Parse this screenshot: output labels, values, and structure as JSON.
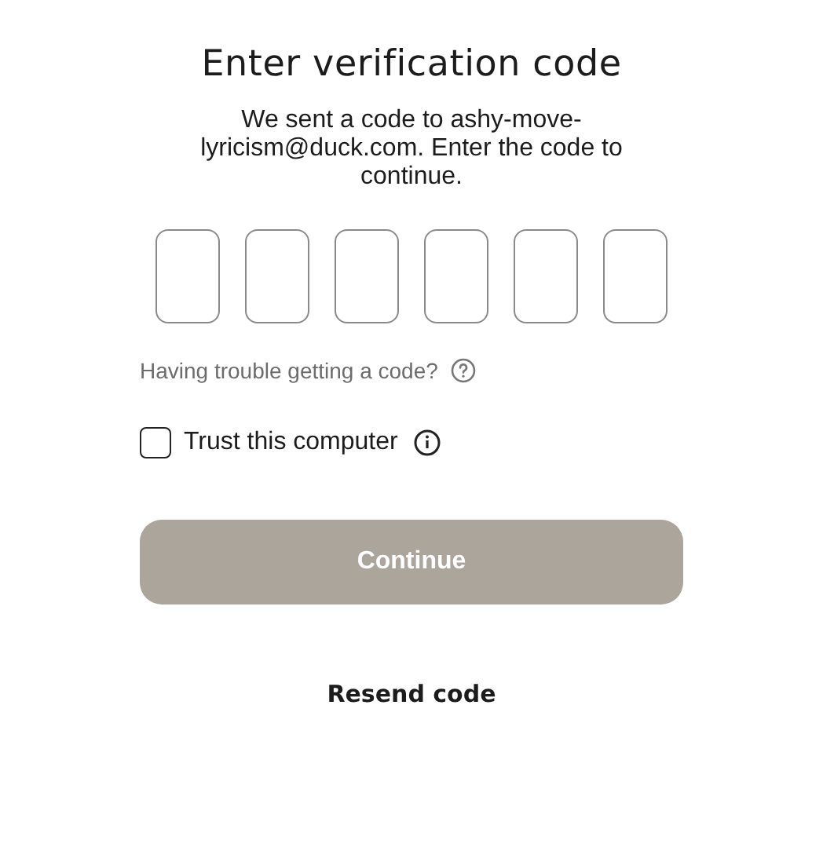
{
  "title": "Enter verification code",
  "message": "We sent a code to ashy-move-lyricism@duck.com. Enter the code to continue.",
  "code_fields": [
    {
      "kind": "digit"
    },
    {
      "kind": "digit"
    },
    {
      "kind": "digit"
    },
    {
      "kind": "digit"
    },
    {
      "kind": "digit"
    },
    {
      "kind": "digit"
    }
  ],
  "help_link": "Having trouble getting a code?",
  "trust": {
    "label": "Trust this computer",
    "checked": false
  },
  "continue_button": {
    "label": "Continue",
    "disabled": true
  },
  "resend_link": "Resend code"
}
